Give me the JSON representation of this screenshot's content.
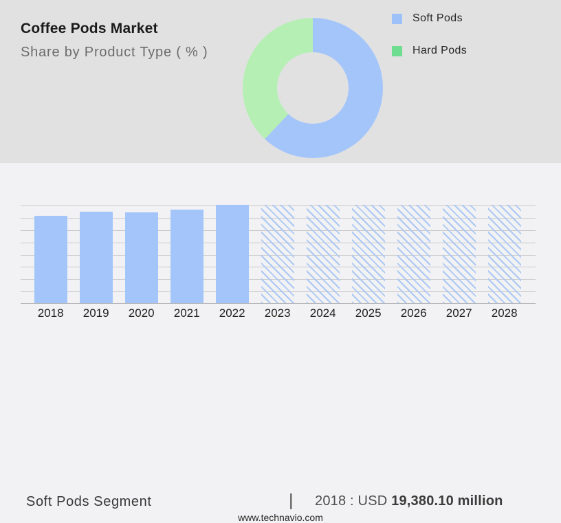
{
  "header": {
    "title": "Coffee Pods Market",
    "subtitle": "Share by Product Type ( % )"
  },
  "legend": [
    {
      "label": "Soft Pods",
      "color": "#9ec1f9"
    },
    {
      "label": "Hard Pods",
      "color": "#6fdd8f"
    }
  ],
  "chart_data": [
    {
      "type": "pie",
      "variant": "donut",
      "title": "Coffee Pods Market — Share by Product Type ( % )",
      "labels": [
        "Soft Pods",
        "Hard Pods"
      ],
      "values": [
        62,
        38
      ],
      "colors": [
        "#a4c5fa",
        "#b5efb4"
      ],
      "start_angle_deg": 0,
      "direction": "clockwise",
      "legend_position": "right",
      "note": "no numeric labels shown on chart; share estimated from arc angles"
    },
    {
      "type": "bar",
      "categories": [
        "2018",
        "2019",
        "2020",
        "2021",
        "2022",
        "2023",
        "2024",
        "2025",
        "2026",
        "2027",
        "2028"
      ],
      "values": [
        89,
        93,
        92,
        95,
        100,
        100,
        100,
        100,
        100,
        100,
        100
      ],
      "forecast_categories": [
        "2023",
        "2024",
        "2025",
        "2026",
        "2027",
        "2028"
      ],
      "bar_color": "#a3c5fa",
      "hatch_color": "#aac8f4",
      "forecast_style": "diagonal-hatch",
      "title": "Soft Pods Segment market size by year",
      "xlabel": "",
      "ylabel": "",
      "ylim": [
        0,
        100
      ],
      "grid": true,
      "note": "y-axis unlabeled; values are relative heights (100 = top gridline)"
    }
  ],
  "footer": {
    "segment_label": "Soft Pods Segment",
    "separator": "|",
    "metric_prefix": "2018 : USD",
    "metric_value": "19,380.10 million",
    "website": "www.technavio.com"
  },
  "colors": {
    "top_panel_bg": "#e1e1e2",
    "bottom_panel_bg": "#f2f2f4",
    "gridline": "#c9c9cb",
    "axis": "#b2b2b4"
  }
}
